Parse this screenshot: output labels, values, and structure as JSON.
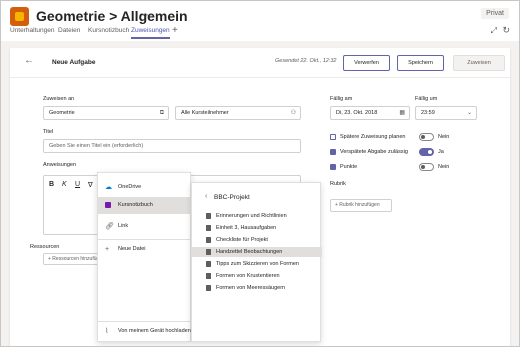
{
  "header": {
    "title": "Geometrie > Allgemein",
    "more": "···",
    "privacy_badge": "Privat",
    "tabs": [
      {
        "label": "Unterhaltungen"
      },
      {
        "label": "Dateien"
      },
      {
        "label": "Kursnotizbuch"
      },
      {
        "label": "Zuweisungen",
        "active": true
      }
    ],
    "add_tab": "+"
  },
  "assignment": {
    "title": "Neue Aufgabe",
    "saved_text": "Gesendet 22. Okt., 12:32",
    "buttons": {
      "discard": "Verwerfen",
      "save": "Speichern",
      "assign": "Zuweisen"
    },
    "assign_to_label": "Zuweisen an",
    "class_value": "Geometrie",
    "students_value": "Alle Kursteilnehmer",
    "title_label": "Titel",
    "title_placeholder": "Geben Sie einen Titel ein (erforderlich)",
    "instructions_label": "Anweisungen",
    "formatting": [
      "B",
      "K",
      "U",
      "∇"
    ],
    "resources_label": "Ressourcen",
    "add_resources": "+ Ressourcen hinzufügen",
    "due_label": "Fällig am",
    "due_date": "Di, 23. Okt. 2018",
    "due_time_label": "Fällig um",
    "due_time": "23:59",
    "options": [
      {
        "label": "Spätere Zuweisung planen",
        "checked": false,
        "toggle_on": false,
        "toggle_text": "Nein"
      },
      {
        "label": "Verspätete Abgabe zulässig",
        "checked": true,
        "toggle_on": true,
        "toggle_text": "Ja"
      },
      {
        "label": "Punkte",
        "checked": true,
        "toggle_on": false,
        "toggle_text": "Nein"
      }
    ],
    "rubric_label": "Rubrik",
    "add_rubric": "+ Rubrik hinzufügen"
  },
  "picker": {
    "sources": [
      {
        "label": "OneDrive",
        "icon": "cloud-icon"
      },
      {
        "label": "Kursnotizbuch",
        "icon": "onenote-icon",
        "selected": true
      },
      {
        "label": "Link",
        "icon": "link-icon"
      },
      {
        "label": "Neue Datei",
        "icon": "plus-icon"
      }
    ],
    "upload": "Von meinem Gerät hochladen",
    "folder": "BBC-Projekt",
    "files": [
      {
        "label": "Erinnerungen und Richtlinien"
      },
      {
        "label": "Einheit 3, Hausaufgaben"
      },
      {
        "label": "Checkliste für Projekt"
      },
      {
        "label": "Handzettel Beobachtungen",
        "selected": true
      },
      {
        "label": "Tipps zum Skizzieren von Formen"
      },
      {
        "label": "Formen von Krustentieren"
      },
      {
        "label": "Formen von Meeressäugern"
      }
    ]
  },
  "colors": {
    "accent": "#6264a7",
    "onenote": "#7719aa",
    "team_icon": "#d35f0e"
  }
}
